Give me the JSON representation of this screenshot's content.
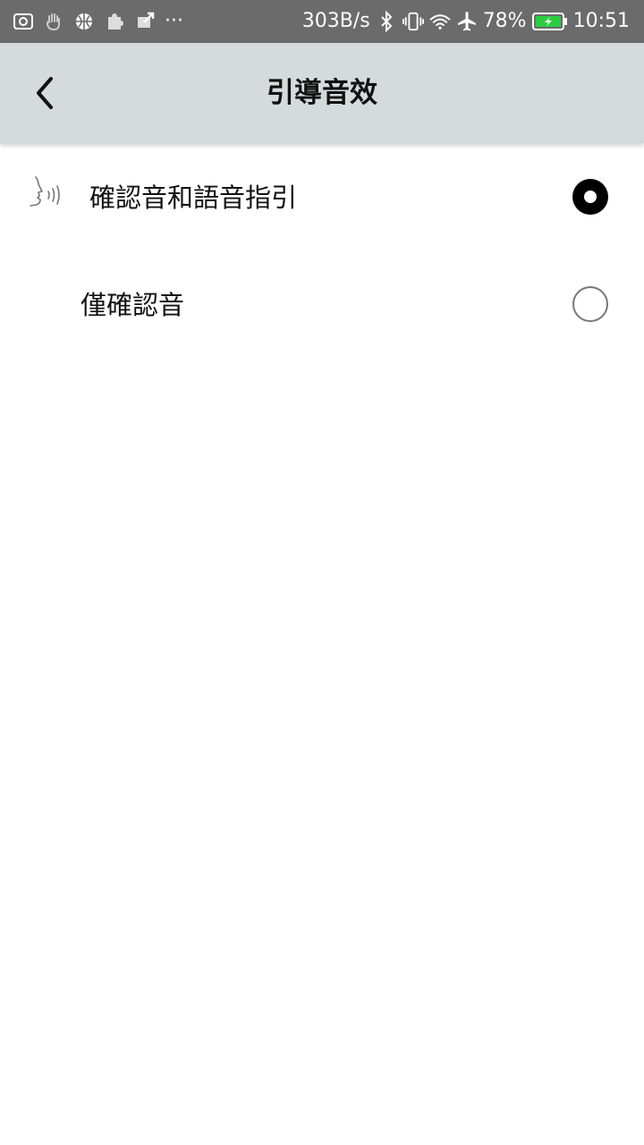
{
  "status_bar": {
    "net_speed": "303B/s",
    "battery_percent": "78%",
    "time": "10:51",
    "more_indicator": "···",
    "battery_color": "#2ecc40",
    "icons": [
      "screenshot-icon",
      "hand-icon",
      "basketball-icon",
      "puzzle-icon",
      "transfer-icon",
      "bluetooth-icon",
      "vibrate-icon",
      "wifi-icon",
      "airplane-icon",
      "battery-charging-icon"
    ]
  },
  "header": {
    "title": "引導音效",
    "back_icon": "chevron-left-icon"
  },
  "options": [
    {
      "label": "確認音和語音指引",
      "selected": true,
      "icon": "voice-speaking-icon"
    },
    {
      "label": "僅確認音",
      "selected": false
    }
  ]
}
